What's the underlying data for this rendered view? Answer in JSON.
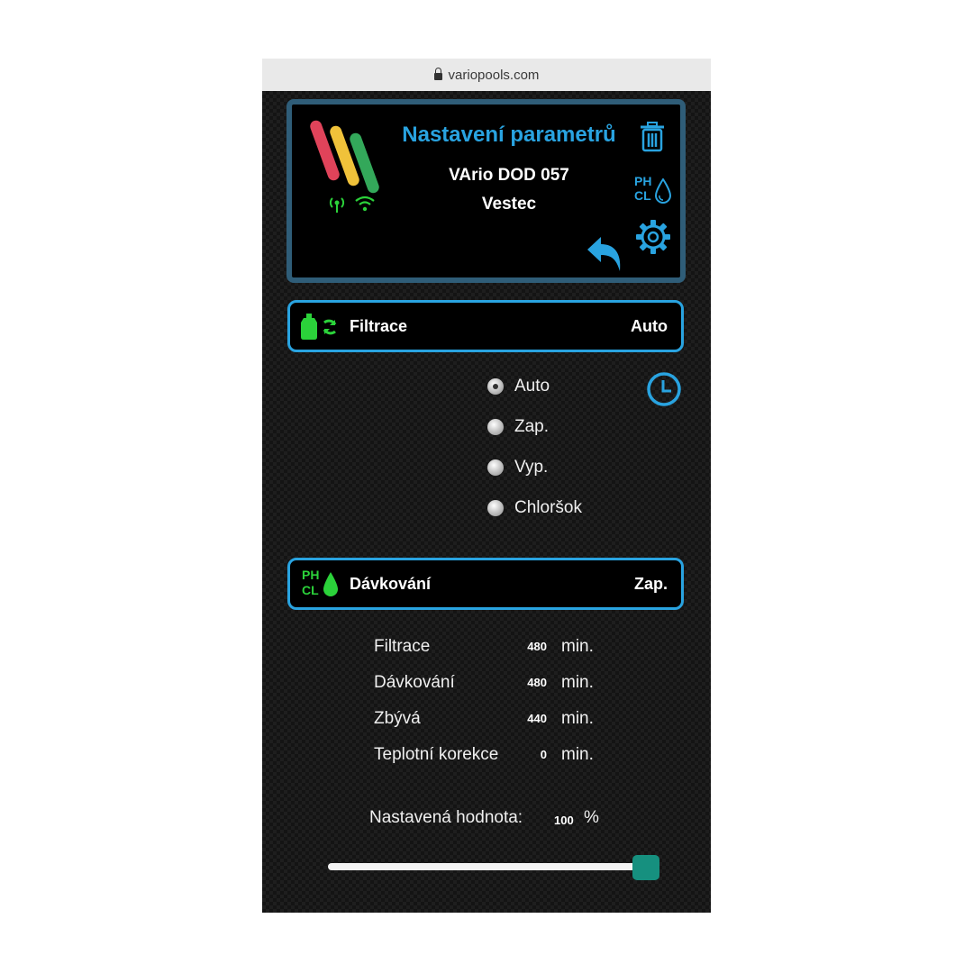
{
  "browser": {
    "url": "variopools.com"
  },
  "header": {
    "title": "Nastavení parametrů",
    "device_name": "VArio DOD 057",
    "location": "Vestec",
    "brand_colors": [
      "#e0435a",
      "#f0c23a",
      "#33a85a"
    ],
    "icons": [
      "antenna-icon",
      "wifi-icon",
      "trash-icon",
      "ph-cl-icon",
      "gear-icon",
      "back-arrow-icon"
    ]
  },
  "filtration": {
    "label": "Filtrace",
    "value": "Auto",
    "icon": "filter-pump-icon",
    "modes": [
      {
        "label": "Auto",
        "checked": true
      },
      {
        "label": "Zap.",
        "checked": false
      },
      {
        "label": "Vyp.",
        "checked": false
      },
      {
        "label": "Chloršok",
        "checked": false
      }
    ]
  },
  "dosing": {
    "label": "Dávkování",
    "value": "Zap.",
    "icon_text": {
      "ph": "PH",
      "cl": "CL"
    }
  },
  "stats": [
    {
      "label": "Filtrace",
      "value": "480",
      "unit": "min."
    },
    {
      "label": "Dávkování",
      "value": "480",
      "unit": "min."
    },
    {
      "label": "Zbývá",
      "value": "440",
      "unit": "min."
    },
    {
      "label": "Teplotní korekce",
      "value": "0",
      "unit": "min."
    }
  ],
  "setpoint": {
    "label": "Nastavená hodnota:",
    "value": "100",
    "unit": "%",
    "slider_fraction": 1.0
  },
  "colors": {
    "accent": "#29a3e0",
    "green": "#2bd23a",
    "slider_thumb": "#16907f"
  }
}
